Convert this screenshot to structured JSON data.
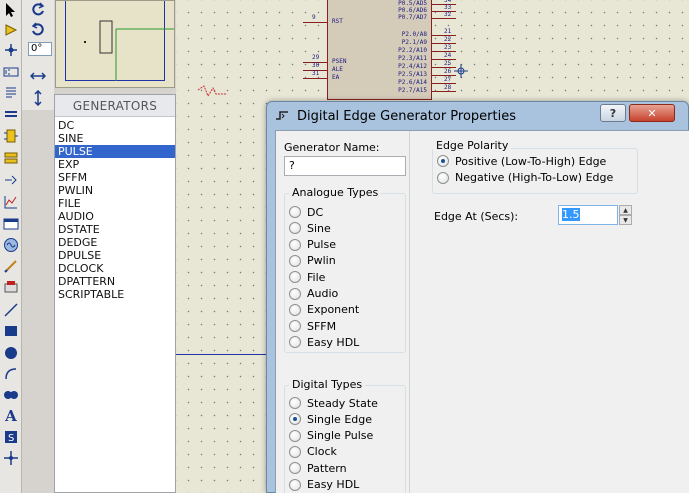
{
  "toolbar": {
    "tools": [
      "selection-icon",
      "component-icon",
      "junction-icon",
      "wire-label-icon",
      "text-script-icon",
      "bus-icon",
      "subcircuit-icon",
      "terminal-icon",
      "device-pin-icon",
      "graph-icon",
      "tape-recorder-icon",
      "generator-icon",
      "voltage-probe-icon",
      "current-probe-icon",
      "virtual-instrument-icon",
      "line-icon",
      "box-icon",
      "circle-icon",
      "arc-icon",
      "path-icon",
      "text-icon",
      "symbol-icon",
      "marker-icon"
    ],
    "rotation_angle": "0°"
  },
  "generators": {
    "header": "GENERATORS",
    "items": [
      {
        "label": "DC",
        "selected": false
      },
      {
        "label": "SINE",
        "selected": false
      },
      {
        "label": "PULSE",
        "selected": true
      },
      {
        "label": "EXP",
        "selected": false
      },
      {
        "label": "SFFM",
        "selected": false
      },
      {
        "label": "PWLIN",
        "selected": false
      },
      {
        "label": "FILE",
        "selected": false
      },
      {
        "label": "AUDIO",
        "selected": false
      },
      {
        "label": "DSTATE",
        "selected": false
      },
      {
        "label": "DEDGE",
        "selected": false
      },
      {
        "label": "DPULSE",
        "selected": false
      },
      {
        "label": "DCLOCK",
        "selected": false
      },
      {
        "label": "DPATTERN",
        "selected": false
      },
      {
        "label": "SCRIPTABLE",
        "selected": false
      }
    ]
  },
  "schematic": {
    "chip_left_pins": [
      {
        "num": "9",
        "name": "RST"
      },
      {
        "num": "29",
        "name": "PSEN"
      },
      {
        "num": "30",
        "name": "ALE"
      },
      {
        "num": "31",
        "name": "EA"
      }
    ],
    "chip_right_pins": [
      {
        "name": "P0.5/AD5",
        "num": "34"
      },
      {
        "name": "P0.6/AD6",
        "num": "33"
      },
      {
        "name": "P0.7/AD7",
        "num": "32"
      },
      {
        "name": "P2.0/A8",
        "num": "21"
      },
      {
        "name": "P2.1/A9",
        "num": "22"
      },
      {
        "name": "P2.2/A10",
        "num": "23"
      },
      {
        "name": "P2.3/A11",
        "num": "24"
      },
      {
        "name": "P2.4/A12",
        "num": "25"
      },
      {
        "name": "P2.5/A13",
        "num": "26"
      },
      {
        "name": "P2.6/A14",
        "num": "27"
      },
      {
        "name": "P2.7/A15",
        "num": "28"
      }
    ]
  },
  "dialog": {
    "title": "Digital Edge Generator Properties",
    "help_label": "?",
    "close_label": "✕",
    "generator_name_label": "Generator Name:",
    "generator_name_value": "?",
    "analogue_types_title": "Analogue Types",
    "analogue_types": [
      {
        "label": "DC",
        "checked": false
      },
      {
        "label": "Sine",
        "checked": false
      },
      {
        "label": "Pulse",
        "checked": false
      },
      {
        "label": "Pwlin",
        "checked": false
      },
      {
        "label": "File",
        "checked": false
      },
      {
        "label": "Audio",
        "checked": false
      },
      {
        "label": "Exponent",
        "checked": false
      },
      {
        "label": "SFFM",
        "checked": false
      },
      {
        "label": "Easy HDL",
        "checked": false
      }
    ],
    "digital_types_title": "Digital Types",
    "digital_types": [
      {
        "label": "Steady State",
        "checked": false
      },
      {
        "label": "Single Edge",
        "checked": true
      },
      {
        "label": "Single Pulse",
        "checked": false
      },
      {
        "label": "Clock",
        "checked": false
      },
      {
        "label": "Pattern",
        "checked": false
      },
      {
        "label": "Easy HDL",
        "checked": false
      }
    ],
    "edge_polarity_title": "Edge Polarity",
    "edge_polarity": [
      {
        "label": "Positive (Low-To-High) Edge",
        "checked": true
      },
      {
        "label": "Negative (High-To-Low) Edge",
        "checked": false
      }
    ],
    "edge_at_label": "Edge At (Secs):",
    "edge_at_value": "1.5"
  },
  "colors": {
    "selection": "#3366cc",
    "canvas": "#e8e6d4",
    "dialog_frame": "#a9c3de"
  }
}
